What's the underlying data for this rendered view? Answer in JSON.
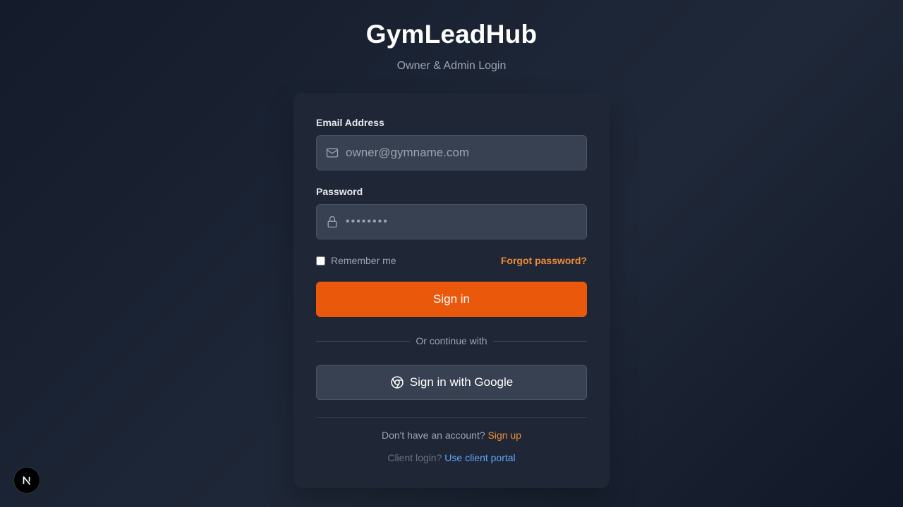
{
  "header": {
    "brand": "GymLeadHub",
    "subtitle": "Owner & Admin Login"
  },
  "form": {
    "email_label": "Email Address",
    "email_placeholder": "owner@gymname.com",
    "email_icon": "mail-icon",
    "password_label": "Password",
    "password_placeholder": "••••••••",
    "password_icon": "lock-icon",
    "remember_label": "Remember me",
    "remember_checked": false,
    "forgot_link": "Forgot password?",
    "submit_label": "Sign in",
    "divider_text": "Or continue with",
    "google_label": "Sign in with Google",
    "google_icon": "chrome-icon"
  },
  "footer": {
    "signup_prompt": "Don't have an account?",
    "signup_link": "Sign up",
    "client_prompt": "Client login?",
    "client_link": "Use client portal"
  },
  "dev_badge": {
    "letter": "N",
    "icon": "nextjs-icon"
  },
  "colors": {
    "accent": "#ea580c",
    "link_orange": "#f08a36",
    "link_blue": "#60a5fa",
    "card_bg": "#1f2737",
    "input_bg": "#374151"
  }
}
